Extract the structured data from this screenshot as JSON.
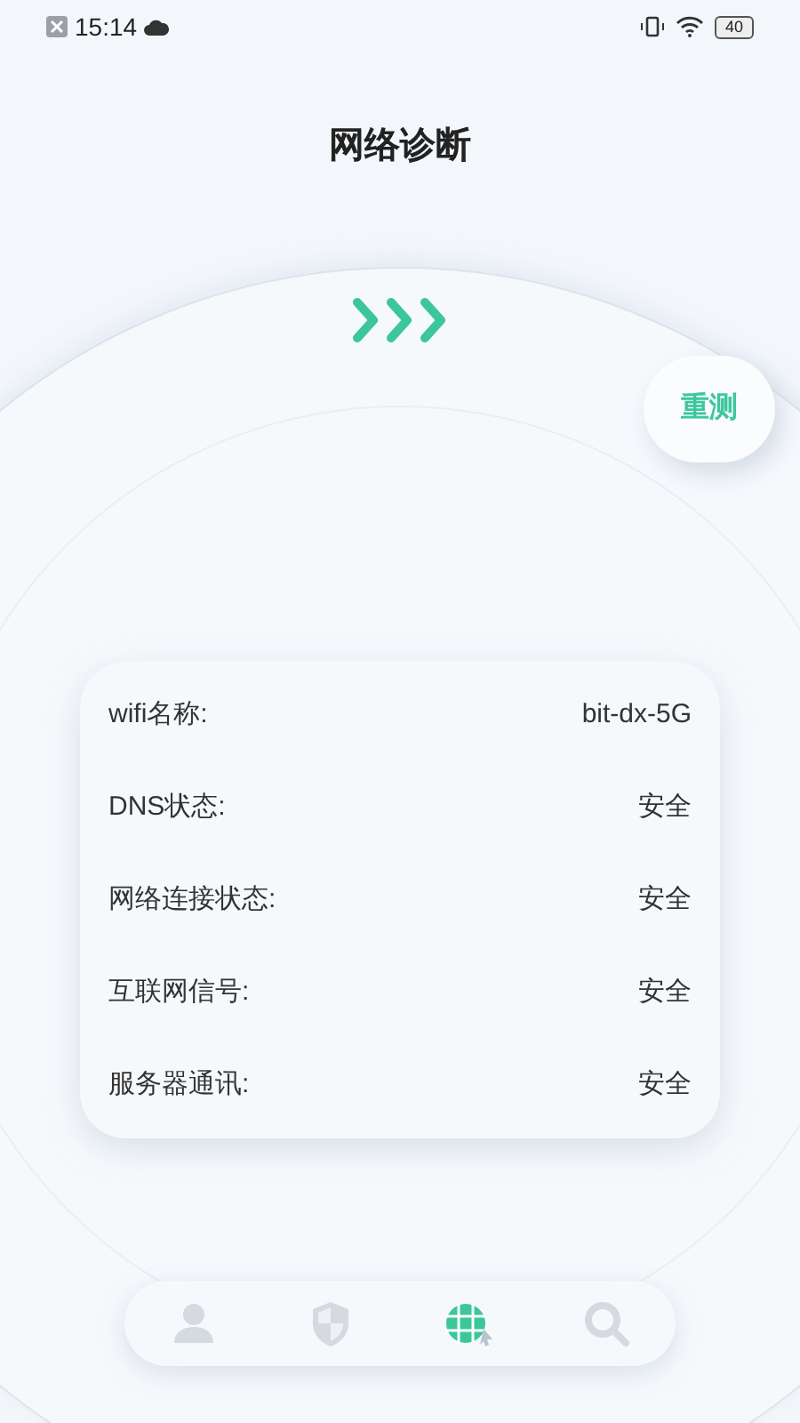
{
  "status_bar": {
    "time": "15:14",
    "battery": "40"
  },
  "title": "网络诊断",
  "retest_button": "重测",
  "info": [
    {
      "label": "wifi名称:",
      "value": "bit-dx-5G"
    },
    {
      "label": "DNS状态:",
      "value": "安全"
    },
    {
      "label": "网络连接状态:",
      "value": "安全"
    },
    {
      "label": "互联网信号:",
      "value": "安全"
    },
    {
      "label": "服务器通讯:",
      "value": "安全"
    }
  ],
  "nav": [
    {
      "kind": "person",
      "selected": false
    },
    {
      "kind": "shield",
      "selected": false
    },
    {
      "kind": "globe",
      "selected": true
    },
    {
      "kind": "search",
      "selected": false
    }
  ]
}
